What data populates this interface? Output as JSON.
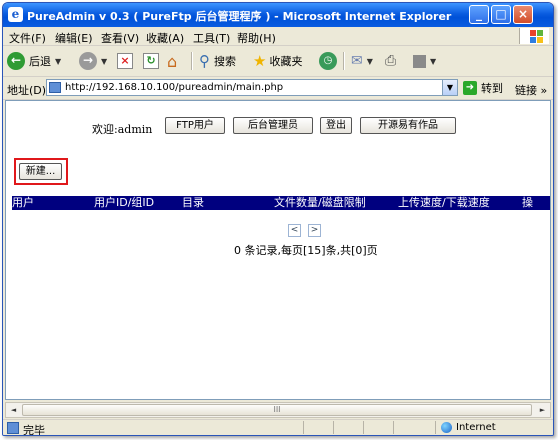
{
  "window": {
    "title": "PureAdmin v 0.3 ( PureFtp 后台管理程序 ) - Microsoft Internet Explorer",
    "app_icon_glyph": "e"
  },
  "menu": [
    "文件(F)",
    "编辑(E)",
    "查看(V)",
    "收藏(A)",
    "工具(T)",
    "帮助(H)"
  ],
  "toolbar": {
    "back_label": "后退",
    "search_label": "搜索",
    "favorites_label": "收藏夹"
  },
  "address": {
    "label": "地址(D)",
    "url": "http://192.168.10.100/pureadmin/main.php",
    "go_label": "转到",
    "links_label": "链接",
    "more": "»"
  },
  "page": {
    "welcome_prefix": "欢迎:",
    "username": "admin",
    "nav_buttons": [
      "FTP用户",
      "后台管理员",
      "登出",
      "开源易有作品"
    ],
    "new_button": "新建...",
    "table_headers": [
      "用户",
      "用户ID/组ID",
      "目录",
      "文件数量/磁盘限制",
      "上传速度/下载速度",
      "操"
    ],
    "pager_prev": "<",
    "pager_next": ">",
    "page_info": "0 条记录,每页[15]条,共[0]页"
  },
  "scrollbar": {
    "left": "◄",
    "right": "►",
    "grip": "III"
  },
  "status": {
    "text": "完毕",
    "zone": "Internet"
  },
  "colors": {
    "title_blue": "#0a5ce0",
    "table_header_bg": "#00007f",
    "highlight_red": "#e0181b"
  }
}
